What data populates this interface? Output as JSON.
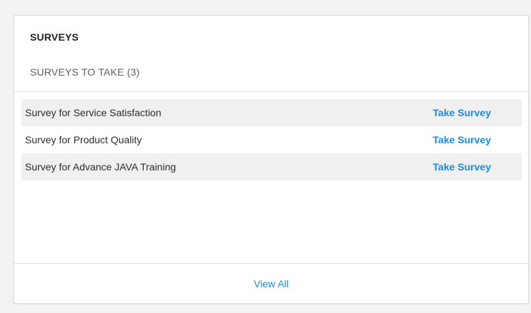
{
  "card": {
    "title": "SURVEYS",
    "subtitle": "SURVEYS TO TAKE (3)",
    "footer_link": "View All"
  },
  "surveys": [
    {
      "name": "Survey for Service Satisfaction",
      "action": "Take Survey"
    },
    {
      "name": "Survey for Product Quality",
      "action": "Take Survey"
    },
    {
      "name": "Survey for Advance JAVA Training",
      "action": "Take Survey"
    }
  ],
  "colors": {
    "link": "#1a8ae6",
    "row_shade": "#f0f0f0",
    "background": "#f3f3f3"
  }
}
